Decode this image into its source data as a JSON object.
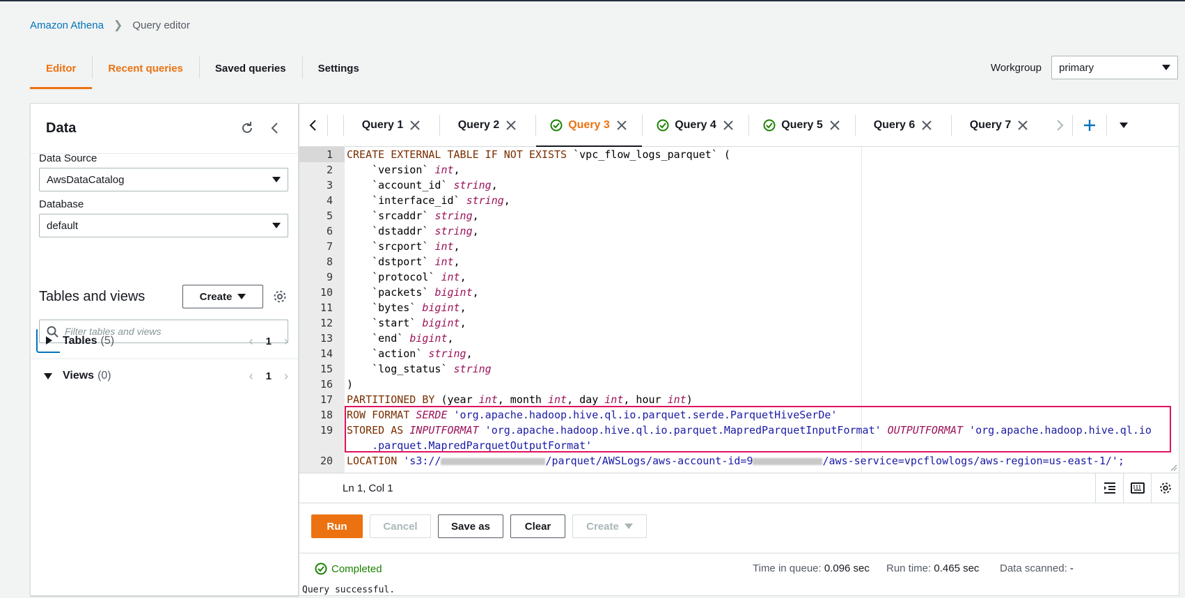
{
  "breadcrumb": {
    "root": "Amazon Athena",
    "current": "Query editor"
  },
  "tabs": [
    "Editor",
    "Recent queries",
    "Saved queries",
    "Settings"
  ],
  "workgroup": {
    "label": "Workgroup",
    "value": "primary"
  },
  "data_panel": {
    "title": "Data",
    "data_source_label": "Data Source",
    "data_source_value": "AwsDataCatalog",
    "database_label": "Database",
    "database_value": "default",
    "tables_views_title": "Tables and views",
    "create_label": "Create",
    "filter_placeholder": "Filter tables and views",
    "tables_label": "Tables",
    "tables_count": "(5)",
    "tables_page": "1",
    "views_label": "Views",
    "views_count": "(0)",
    "views_page": "1"
  },
  "query_tabs": [
    {
      "label": "Query 1",
      "status": "none"
    },
    {
      "label": "Query 2",
      "status": "none"
    },
    {
      "label": "Query 3",
      "status": "success",
      "active": true
    },
    {
      "label": "Query 4",
      "status": "success"
    },
    {
      "label": "Query 5",
      "status": "success"
    },
    {
      "label": "Query 6",
      "status": "none"
    },
    {
      "label": "Query 7",
      "status": "none"
    }
  ],
  "editor": {
    "line_numbers": [
      "1",
      "2",
      "3",
      "4",
      "5",
      "6",
      "7",
      "8",
      "9",
      "10",
      "11",
      "12",
      "13",
      "14",
      "15",
      "16",
      "17",
      "18",
      "19",
      "",
      "20"
    ],
    "code": {
      "l1a": "CREATE EXTERNAL TABLE IF NOT EXISTS",
      "l1b": " `vpc_flow_logs_parquet` (",
      "l2a": "    `version` ",
      "l2b": "int",
      "l2c": ",",
      "l3a": "    `account_id` ",
      "l3b": "string",
      "l3c": ",",
      "l4a": "    `interface_id` ",
      "l4b": "string",
      "l4c": ",",
      "l5a": "    `srcaddr` ",
      "l5b": "string",
      "l5c": ",",
      "l6a": "    `dstaddr` ",
      "l6b": "string",
      "l6c": ",",
      "l7a": "    `srcport` ",
      "l7b": "int",
      "l7c": ",",
      "l8a": "    `dstport` ",
      "l8b": "int",
      "l8c": ",",
      "l9a": "    `protocol` ",
      "l9b": "int",
      "l9c": ",",
      "l10a": "    `packets` ",
      "l10b": "bigint",
      "l10c": ",",
      "l11a": "    `bytes` ",
      "l11b": "bigint",
      "l11c": ",",
      "l12a": "    `start` ",
      "l12b": "bigint",
      "l12c": ",",
      "l13a": "    `end` ",
      "l13b": "bigint",
      "l13c": ",",
      "l14a": "    `action` ",
      "l14b": "string",
      "l14c": ",",
      "l15a": "    `log_status` ",
      "l15b": "string",
      "l16": ")",
      "l17a": "PARTITIONED BY",
      "l17b": " (year ",
      "l17c": "int",
      "l17d": ", month ",
      "l17e": "int",
      "l17f": ", day ",
      "l17g": "int",
      "l17h": ", hour ",
      "l17i": "int",
      "l17j": ")",
      "l18a": "ROW FORMAT ",
      "l18b": "SERDE",
      "l18c": " 'org.apache.hadoop.hive.ql.io.parquet.serde.ParquetHiveSerDe'",
      "l19a": "STORED AS ",
      "l19b": "INPUTFORMAT",
      "l19c": " 'org.apache.hadoop.hive.ql.io.parquet.MapredParquetInputFormat' ",
      "l19d": "OUTPUTFORMAT",
      "l19e": " 'org.apache.hadoop.hive.ql.io",
      "l19w": "    .parquet.MapredParquetOutputFormat'",
      "l20a": "LOCATION",
      "l20b": " 's3://",
      "l20c": "/parquet/AWSLogs/aws-account-id=9",
      "l20d": "/aws-service=vpcflowlogs/aws-region=us-east-1/';"
    }
  },
  "status": {
    "position": "Ln 1, Col 1"
  },
  "buttons": {
    "run": "Run",
    "cancel": "Cancel",
    "save_as": "Save as",
    "clear": "Clear",
    "create": "Create"
  },
  "result": {
    "status": "Completed",
    "time_in_queue_label": "Time in queue:",
    "time_in_queue": "0.096 sec",
    "run_time_label": "Run time:",
    "run_time": "0.465 sec",
    "data_scanned_label": "Data scanned:",
    "data_scanned": "-",
    "message": "Query successful."
  },
  "colors": {
    "accent": "#ec7211",
    "link": "#0073bb",
    "success": "#1d8102",
    "highlight_box": "#e0115f"
  }
}
